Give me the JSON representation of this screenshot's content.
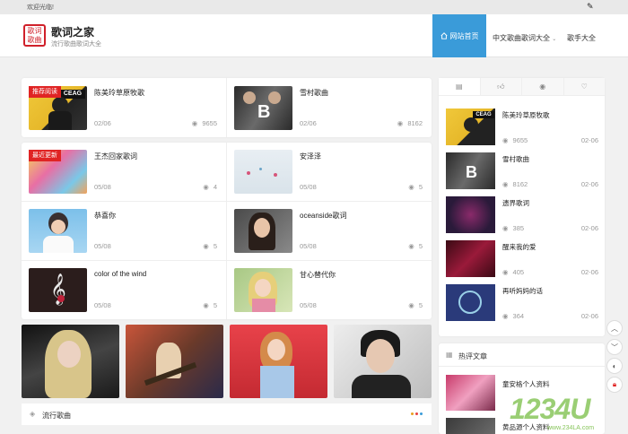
{
  "topbar": {
    "welcome": "欢迎光临!",
    "edit_icon": "pencil-icon"
  },
  "header": {
    "logo_text": "歌词 歌曲",
    "title": "歌词之家",
    "subtitle": "流行歌曲歌词大全",
    "nav": [
      {
        "label": "网站首页",
        "icon": "home-icon",
        "active": true
      },
      {
        "label": "中文歌曲歌词大全",
        "icon": "chevron-down-icon"
      },
      {
        "label": "歌手大全"
      }
    ]
  },
  "featured": [
    {
      "tag": "推荐阅读",
      "title": "陈美玲草原牧歌",
      "date": "02/06",
      "views": "9655"
    },
    {
      "title": "雪村歌曲",
      "date": "02/06",
      "views": "8162"
    }
  ],
  "songs": [
    {
      "tag": "最近更新",
      "title": "王杰回家歌词",
      "date": "05/08",
      "views": "4"
    },
    {
      "title": "安泽泽",
      "date": "05/08",
      "views": "5"
    },
    {
      "title": "恭喜你",
      "date": "05/08",
      "views": "5"
    },
    {
      "title": "oceanside歌词",
      "date": "05/08",
      "views": "5"
    },
    {
      "title": "color of the wind",
      "date": "05/08",
      "views": "5"
    },
    {
      "title": "甘心替代你",
      "date": "05/08",
      "views": "5"
    }
  ],
  "section": {
    "label": "流行歌曲"
  },
  "sidebar": {
    "tabs": [
      "card-icon",
      "thumbs-up-icon",
      "eye-icon",
      "heart-icon"
    ],
    "items": [
      {
        "title": "陈美玲草原牧歌",
        "views": "9655",
        "date": "02-06"
      },
      {
        "title": "雪村歌曲",
        "views": "8162",
        "date": "02-06"
      },
      {
        "title": "遗界歌词",
        "views": "385",
        "date": "02-06"
      },
      {
        "title": "醒来我的爱",
        "views": "405",
        "date": "02-06"
      },
      {
        "title": "再听妈妈的话",
        "views": "364",
        "date": "02-06"
      }
    ]
  },
  "hot": {
    "label": "热评文章",
    "items": [
      {
        "title": "童安格个人资料"
      },
      {
        "title": "黄品源个人资料"
      }
    ]
  },
  "watermark": {
    "main": "1234U",
    "sub": "www.234LA.com"
  }
}
